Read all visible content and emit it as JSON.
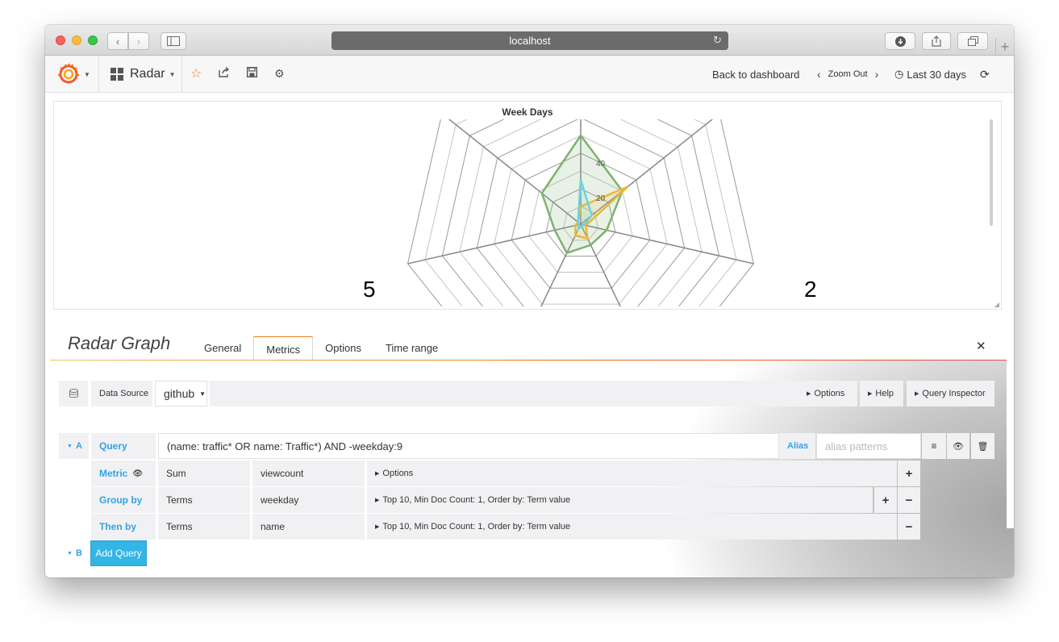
{
  "browser": {
    "address": "localhost"
  },
  "navbar": {
    "dashboard_name": "Radar",
    "back_to_dashboard": "Back to dashboard",
    "zoom_out": "Zoom Out",
    "time_range": "Last 30 days"
  },
  "panel": {
    "title": "Week Days",
    "axis_label_left": "5",
    "axis_label_right": "2",
    "ring_label_1": "20",
    "ring_label_2": "40"
  },
  "chart_data": {
    "type": "radar",
    "title": "Week Days",
    "axis_labels_visible": [
      "5",
      "2"
    ],
    "ring_ticks": [
      20,
      40
    ],
    "series": [
      {
        "color": "#7eb26d",
        "values": [
          50,
          30,
          15,
          13,
          18,
          15,
          28
        ]
      },
      {
        "color": "#eab839",
        "values": [
          10,
          34,
          3,
          9,
          7,
          3,
          2
        ]
      },
      {
        "color": "#6ed0e0",
        "values": [
          25,
          8,
          2,
          1,
          3,
          1,
          2
        ]
      }
    ]
  },
  "editor": {
    "title": "Radar Graph",
    "tabs": [
      "General",
      "Metrics",
      "Options",
      "Time range"
    ],
    "active_tab": "Metrics"
  },
  "datasource": {
    "label": "Data Source",
    "value": "github",
    "options_button": "Options",
    "help_button": "Help",
    "query_inspector_button": "Query Inspector"
  },
  "query_a": {
    "ref": "A",
    "label": "Query",
    "value": "(name: traffic* OR name: Traffic*) AND -weekday:9",
    "alias_label": "Alias",
    "alias_placeholder": "alias patterns",
    "metric": {
      "label": "Metric",
      "type": "Sum",
      "field": "viewcount",
      "options": "Options"
    },
    "group_by": {
      "label": "Group by",
      "type": "Terms",
      "field": "weekday",
      "options": "Top 10, Min Doc Count: 1, Order by: Term value"
    },
    "then_by": {
      "label": "Then by",
      "type": "Terms",
      "field": "name",
      "options": "Top 10, Min Doc Count: 1, Order by: Term value"
    }
  },
  "query_b": {
    "ref": "B",
    "add_label": "Add Query"
  },
  "colors": {
    "accent_orange": "#eb7b18",
    "link_blue": "#33a2e5",
    "add_query_bg": "#33b5e5"
  }
}
